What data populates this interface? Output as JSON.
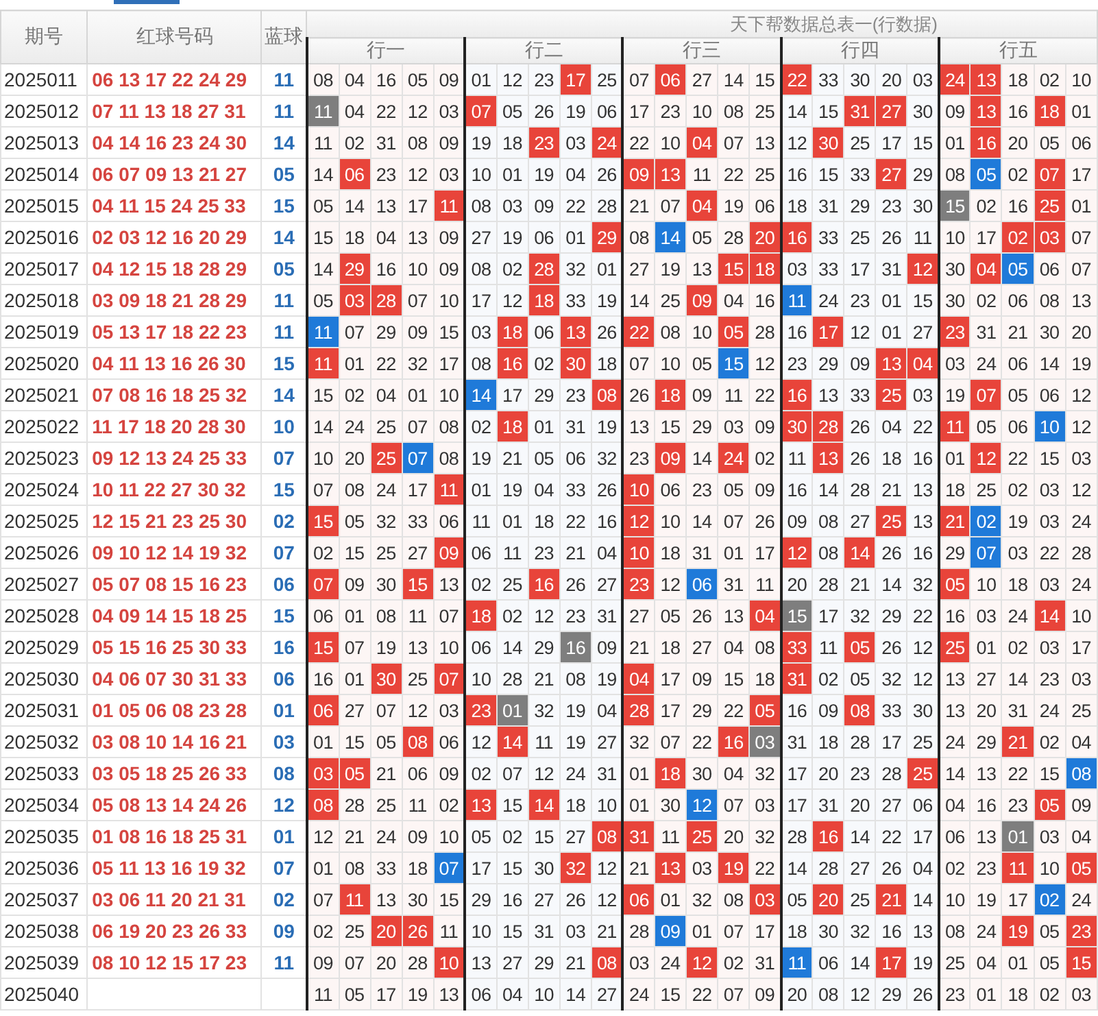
{
  "header": {
    "title": "天下帮数据总表一(行数据)",
    "columns": [
      "期号",
      "红球号码",
      "蓝球"
    ],
    "groups": [
      "行一",
      "行二",
      "行三",
      "行四",
      "行五"
    ]
  },
  "rows": [
    {
      "issue": "2025011",
      "red": "06 13 17 22 24 29",
      "blue": "11",
      "cells": [
        {
          "n": "08"
        },
        {
          "n": "04"
        },
        {
          "n": "16"
        },
        {
          "n": "05"
        },
        {
          "n": "09"
        },
        {
          "n": "01"
        },
        {
          "n": "12"
        },
        {
          "n": "23"
        },
        {
          "n": "17",
          "color": "#e8443a"
        },
        {
          "n": "25"
        },
        {
          "n": "07"
        },
        {
          "n": "06",
          "color": "#e8443a"
        },
        {
          "n": "27"
        },
        {
          "n": "14"
        },
        {
          "n": "15"
        },
        {
          "n": "22",
          "color": "#e8443a"
        },
        {
          "n": "33"
        },
        {
          "n": "30"
        },
        {
          "n": "20"
        },
        {
          "n": "03"
        },
        {
          "n": "24",
          "color": "#e8443a"
        },
        {
          "n": "13",
          "color": "#e8443a"
        },
        {
          "n": "18"
        },
        {
          "n": "02"
        },
        {
          "n": "10"
        }
      ]
    },
    {
      "issue": "2025012",
      "red": "07 11 13 18 27 31",
      "blue": "11",
      "cells": [
        {
          "n": "11",
          "color": "#7e7e7e"
        },
        {
          "n": "04"
        },
        {
          "n": "22"
        },
        {
          "n": "12"
        },
        {
          "n": "03"
        },
        {
          "n": "07",
          "color": "#e8443a"
        },
        {
          "n": "05"
        },
        {
          "n": "26"
        },
        {
          "n": "19"
        },
        {
          "n": "06"
        },
        {
          "n": "17"
        },
        {
          "n": "23"
        },
        {
          "n": "10"
        },
        {
          "n": "08"
        },
        {
          "n": "25"
        },
        {
          "n": "14"
        },
        {
          "n": "15"
        },
        {
          "n": "31",
          "color": "#e8443a"
        },
        {
          "n": "27",
          "color": "#e8443a"
        },
        {
          "n": "30"
        },
        {
          "n": "09"
        },
        {
          "n": "13",
          "color": "#e8443a"
        },
        {
          "n": "16"
        },
        {
          "n": "18",
          "color": "#e8443a"
        },
        {
          "n": "01"
        }
      ]
    },
    {
      "issue": "2025013",
      "red": "04 14 16 23 24 30",
      "blue": "14",
      "cells": [
        {
          "n": "11"
        },
        {
          "n": "02"
        },
        {
          "n": "31"
        },
        {
          "n": "08"
        },
        {
          "n": "09"
        },
        {
          "n": "19"
        },
        {
          "n": "18"
        },
        {
          "n": "23",
          "color": "#e8443a"
        },
        {
          "n": "03"
        },
        {
          "n": "24",
          "color": "#e8443a"
        },
        {
          "n": "22"
        },
        {
          "n": "10"
        },
        {
          "n": "04",
          "color": "#e8443a"
        },
        {
          "n": "07"
        },
        {
          "n": "13"
        },
        {
          "n": "12"
        },
        {
          "n": "30",
          "color": "#e8443a"
        },
        {
          "n": "25"
        },
        {
          "n": "17"
        },
        {
          "n": "15"
        },
        {
          "n": "01"
        },
        {
          "n": "16",
          "color": "#e8443a"
        },
        {
          "n": "20"
        },
        {
          "n": "05"
        },
        {
          "n": "06"
        }
      ]
    },
    {
      "issue": "2025014",
      "red": "06 07 09 13 21 27",
      "blue": "05",
      "cells": [
        {
          "n": "14"
        },
        {
          "n": "06",
          "color": "#e8443a"
        },
        {
          "n": "23"
        },
        {
          "n": "12"
        },
        {
          "n": "03"
        },
        {
          "n": "10"
        },
        {
          "n": "01"
        },
        {
          "n": "19"
        },
        {
          "n": "04"
        },
        {
          "n": "26"
        },
        {
          "n": "09",
          "color": "#e8443a"
        },
        {
          "n": "13",
          "color": "#e8443a"
        },
        {
          "n": "11"
        },
        {
          "n": "22"
        },
        {
          "n": "25"
        },
        {
          "n": "16"
        },
        {
          "n": "15"
        },
        {
          "n": "33"
        },
        {
          "n": "27",
          "color": "#e8443a"
        },
        {
          "n": "29"
        },
        {
          "n": "08"
        },
        {
          "n": "05",
          "color": "#1f7ad9"
        },
        {
          "n": "02"
        },
        {
          "n": "07",
          "color": "#e8443a"
        },
        {
          "n": "17"
        }
      ]
    },
    {
      "issue": "2025015",
      "red": "04 11 15 24 25 33",
      "blue": "15",
      "cells": [
        {
          "n": "05"
        },
        {
          "n": "14"
        },
        {
          "n": "13"
        },
        {
          "n": "17"
        },
        {
          "n": "11",
          "color": "#e8443a"
        },
        {
          "n": "08"
        },
        {
          "n": "03"
        },
        {
          "n": "09"
        },
        {
          "n": "22"
        },
        {
          "n": "28"
        },
        {
          "n": "21"
        },
        {
          "n": "07"
        },
        {
          "n": "04",
          "color": "#e8443a"
        },
        {
          "n": "19"
        },
        {
          "n": "06"
        },
        {
          "n": "18"
        },
        {
          "n": "31"
        },
        {
          "n": "29"
        },
        {
          "n": "23"
        },
        {
          "n": "30"
        },
        {
          "n": "15",
          "color": "#7e7e7e"
        },
        {
          "n": "02"
        },
        {
          "n": "16"
        },
        {
          "n": "25",
          "color": "#e8443a"
        },
        {
          "n": "01"
        }
      ]
    },
    {
      "issue": "2025016",
      "red": "02 03 12 16 20 29",
      "blue": "14",
      "cells": [
        {
          "n": "15"
        },
        {
          "n": "18"
        },
        {
          "n": "04"
        },
        {
          "n": "13"
        },
        {
          "n": "09"
        },
        {
          "n": "27"
        },
        {
          "n": "19"
        },
        {
          "n": "06"
        },
        {
          "n": "01"
        },
        {
          "n": "29",
          "color": "#e8443a"
        },
        {
          "n": "08"
        },
        {
          "n": "14",
          "color": "#1f7ad9"
        },
        {
          "n": "05"
        },
        {
          "n": "28"
        },
        {
          "n": "20",
          "color": "#e8443a"
        },
        {
          "n": "16",
          "color": "#e8443a"
        },
        {
          "n": "33"
        },
        {
          "n": "25"
        },
        {
          "n": "26"
        },
        {
          "n": "11"
        },
        {
          "n": "10"
        },
        {
          "n": "17"
        },
        {
          "n": "02",
          "color": "#e8443a"
        },
        {
          "n": "03",
          "color": "#e8443a"
        },
        {
          "n": "07"
        }
      ]
    },
    {
      "issue": "2025017",
      "red": "04 12 15 18 28 29",
      "blue": "05",
      "cells": [
        {
          "n": "14"
        },
        {
          "n": "29",
          "color": "#e8443a"
        },
        {
          "n": "16"
        },
        {
          "n": "10"
        },
        {
          "n": "09"
        },
        {
          "n": "08"
        },
        {
          "n": "02"
        },
        {
          "n": "28",
          "color": "#e8443a"
        },
        {
          "n": "32"
        },
        {
          "n": "01"
        },
        {
          "n": "27"
        },
        {
          "n": "19"
        },
        {
          "n": "13"
        },
        {
          "n": "15",
          "color": "#e8443a"
        },
        {
          "n": "18",
          "color": "#e8443a"
        },
        {
          "n": "03"
        },
        {
          "n": "33"
        },
        {
          "n": "17"
        },
        {
          "n": "31"
        },
        {
          "n": "12",
          "color": "#e8443a"
        },
        {
          "n": "30"
        },
        {
          "n": "04",
          "color": "#e8443a"
        },
        {
          "n": "05",
          "color": "#1f7ad9"
        },
        {
          "n": "06"
        },
        {
          "n": "07"
        }
      ]
    },
    {
      "issue": "2025018",
      "red": "03 09 18 21 28 29",
      "blue": "11",
      "cells": [
        {
          "n": "05"
        },
        {
          "n": "03",
          "color": "#e8443a"
        },
        {
          "n": "28",
          "color": "#e8443a"
        },
        {
          "n": "07"
        },
        {
          "n": "10"
        },
        {
          "n": "17"
        },
        {
          "n": "12"
        },
        {
          "n": "18",
          "color": "#e8443a"
        },
        {
          "n": "33"
        },
        {
          "n": "19"
        },
        {
          "n": "14"
        },
        {
          "n": "25"
        },
        {
          "n": "09",
          "color": "#e8443a"
        },
        {
          "n": "04"
        },
        {
          "n": "16"
        },
        {
          "n": "11",
          "color": "#1f7ad9"
        },
        {
          "n": "24"
        },
        {
          "n": "23"
        },
        {
          "n": "01"
        },
        {
          "n": "15"
        },
        {
          "n": "30"
        },
        {
          "n": "02"
        },
        {
          "n": "06"
        },
        {
          "n": "08"
        },
        {
          "n": "13"
        }
      ]
    },
    {
      "issue": "2025019",
      "red": "05 13 17 18 22 23",
      "blue": "11",
      "cells": [
        {
          "n": "11",
          "color": "#1f7ad9"
        },
        {
          "n": "07"
        },
        {
          "n": "29"
        },
        {
          "n": "09"
        },
        {
          "n": "15"
        },
        {
          "n": "03"
        },
        {
          "n": "18",
          "color": "#e8443a"
        },
        {
          "n": "06"
        },
        {
          "n": "13",
          "color": "#e8443a"
        },
        {
          "n": "26"
        },
        {
          "n": "22",
          "color": "#e8443a"
        },
        {
          "n": "08"
        },
        {
          "n": "10"
        },
        {
          "n": "05",
          "color": "#e8443a"
        },
        {
          "n": "28"
        },
        {
          "n": "16"
        },
        {
          "n": "17",
          "color": "#e8443a"
        },
        {
          "n": "12"
        },
        {
          "n": "01"
        },
        {
          "n": "27"
        },
        {
          "n": "23",
          "color": "#e8443a"
        },
        {
          "n": "31"
        },
        {
          "n": "21"
        },
        {
          "n": "30"
        },
        {
          "n": "20"
        }
      ]
    },
    {
      "issue": "2025020",
      "red": "04 11 13 16 26 30",
      "blue": "15",
      "cells": [
        {
          "n": "11",
          "color": "#e8443a"
        },
        {
          "n": "01"
        },
        {
          "n": "22"
        },
        {
          "n": "32"
        },
        {
          "n": "17"
        },
        {
          "n": "08"
        },
        {
          "n": "16",
          "color": "#e8443a"
        },
        {
          "n": "02"
        },
        {
          "n": "30",
          "color": "#e8443a"
        },
        {
          "n": "18"
        },
        {
          "n": "07"
        },
        {
          "n": "10"
        },
        {
          "n": "05"
        },
        {
          "n": "15",
          "color": "#1f7ad9"
        },
        {
          "n": "12"
        },
        {
          "n": "23"
        },
        {
          "n": "29"
        },
        {
          "n": "09"
        },
        {
          "n": "13",
          "color": "#e8443a"
        },
        {
          "n": "04",
          "color": "#e8443a"
        },
        {
          "n": "03"
        },
        {
          "n": "24"
        },
        {
          "n": "06"
        },
        {
          "n": "14"
        },
        {
          "n": "19"
        }
      ]
    },
    {
      "issue": "2025021",
      "red": "07 08 16 18 25 32",
      "blue": "14",
      "cells": [
        {
          "n": "15"
        },
        {
          "n": "02"
        },
        {
          "n": "04"
        },
        {
          "n": "01"
        },
        {
          "n": "10"
        },
        {
          "n": "14",
          "color": "#1f7ad9"
        },
        {
          "n": "17"
        },
        {
          "n": "29"
        },
        {
          "n": "23"
        },
        {
          "n": "08",
          "color": "#e8443a"
        },
        {
          "n": "26"
        },
        {
          "n": "18",
          "color": "#e8443a"
        },
        {
          "n": "09"
        },
        {
          "n": "11"
        },
        {
          "n": "22"
        },
        {
          "n": "16",
          "color": "#e8443a"
        },
        {
          "n": "13"
        },
        {
          "n": "33"
        },
        {
          "n": "25",
          "color": "#e8443a"
        },
        {
          "n": "03"
        },
        {
          "n": "19"
        },
        {
          "n": "07",
          "color": "#e8443a"
        },
        {
          "n": "05"
        },
        {
          "n": "06"
        },
        {
          "n": "12"
        }
      ]
    },
    {
      "issue": "2025022",
      "red": "11 17 18 20 28 30",
      "blue": "10",
      "cells": [
        {
          "n": "14"
        },
        {
          "n": "24"
        },
        {
          "n": "25"
        },
        {
          "n": "07"
        },
        {
          "n": "08"
        },
        {
          "n": "02"
        },
        {
          "n": "18",
          "color": "#e8443a"
        },
        {
          "n": "01"
        },
        {
          "n": "31"
        },
        {
          "n": "19"
        },
        {
          "n": "13"
        },
        {
          "n": "15"
        },
        {
          "n": "29"
        },
        {
          "n": "03"
        },
        {
          "n": "09"
        },
        {
          "n": "30",
          "color": "#e8443a"
        },
        {
          "n": "28",
          "color": "#e8443a"
        },
        {
          "n": "26"
        },
        {
          "n": "04"
        },
        {
          "n": "22"
        },
        {
          "n": "11",
          "color": "#e8443a"
        },
        {
          "n": "05"
        },
        {
          "n": "06"
        },
        {
          "n": "10",
          "color": "#1f7ad9"
        },
        {
          "n": "12"
        }
      ]
    },
    {
      "issue": "2025023",
      "red": "09 12 13 24 25 33",
      "blue": "07",
      "cells": [
        {
          "n": "10"
        },
        {
          "n": "20"
        },
        {
          "n": "25",
          "color": "#e8443a"
        },
        {
          "n": "07",
          "color": "#1f7ad9"
        },
        {
          "n": "08"
        },
        {
          "n": "19"
        },
        {
          "n": "21"
        },
        {
          "n": "05"
        },
        {
          "n": "06"
        },
        {
          "n": "32"
        },
        {
          "n": "23"
        },
        {
          "n": "09",
          "color": "#e8443a"
        },
        {
          "n": "14"
        },
        {
          "n": "24",
          "color": "#e8443a"
        },
        {
          "n": "02"
        },
        {
          "n": "11"
        },
        {
          "n": "13",
          "color": "#e8443a"
        },
        {
          "n": "26"
        },
        {
          "n": "18"
        },
        {
          "n": "16"
        },
        {
          "n": "01"
        },
        {
          "n": "12",
          "color": "#e8443a"
        },
        {
          "n": "22"
        },
        {
          "n": "15"
        },
        {
          "n": "03"
        }
      ]
    },
    {
      "issue": "2025024",
      "red": "10 11 22 27 30 32",
      "blue": "15",
      "cells": [
        {
          "n": "07"
        },
        {
          "n": "08"
        },
        {
          "n": "24"
        },
        {
          "n": "17"
        },
        {
          "n": "11",
          "color": "#e8443a"
        },
        {
          "n": "01"
        },
        {
          "n": "19"
        },
        {
          "n": "04"
        },
        {
          "n": "33"
        },
        {
          "n": "26"
        },
        {
          "n": "10",
          "color": "#e8443a"
        },
        {
          "n": "06"
        },
        {
          "n": "23"
        },
        {
          "n": "05"
        },
        {
          "n": "09"
        },
        {
          "n": "16"
        },
        {
          "n": "14"
        },
        {
          "n": "28"
        },
        {
          "n": "21"
        },
        {
          "n": "13"
        },
        {
          "n": "18"
        },
        {
          "n": "25"
        },
        {
          "n": "02"
        },
        {
          "n": "03"
        },
        {
          "n": "12"
        }
      ]
    },
    {
      "issue": "2025025",
      "red": "12 15 21 23 25 30",
      "blue": "02",
      "cells": [
        {
          "n": "15",
          "color": "#e8443a"
        },
        {
          "n": "05"
        },
        {
          "n": "32"
        },
        {
          "n": "33"
        },
        {
          "n": "06"
        },
        {
          "n": "11"
        },
        {
          "n": "01"
        },
        {
          "n": "18"
        },
        {
          "n": "22"
        },
        {
          "n": "16"
        },
        {
          "n": "12",
          "color": "#e8443a"
        },
        {
          "n": "10"
        },
        {
          "n": "14"
        },
        {
          "n": "07"
        },
        {
          "n": "26"
        },
        {
          "n": "09"
        },
        {
          "n": "08"
        },
        {
          "n": "27"
        },
        {
          "n": "25",
          "color": "#e8443a"
        },
        {
          "n": "13"
        },
        {
          "n": "21",
          "color": "#e8443a"
        },
        {
          "n": "02",
          "color": "#1f7ad9"
        },
        {
          "n": "19"
        },
        {
          "n": "03"
        },
        {
          "n": "24"
        }
      ]
    },
    {
      "issue": "2025026",
      "red": "09 10 12 14 19 32",
      "blue": "07",
      "cells": [
        {
          "n": "02"
        },
        {
          "n": "15"
        },
        {
          "n": "25"
        },
        {
          "n": "27"
        },
        {
          "n": "09",
          "color": "#e8443a"
        },
        {
          "n": "06"
        },
        {
          "n": "11"
        },
        {
          "n": "23"
        },
        {
          "n": "21"
        },
        {
          "n": "04"
        },
        {
          "n": "10",
          "color": "#e8443a"
        },
        {
          "n": "18"
        },
        {
          "n": "31"
        },
        {
          "n": "01"
        },
        {
          "n": "17"
        },
        {
          "n": "12",
          "color": "#e8443a"
        },
        {
          "n": "08"
        },
        {
          "n": "14",
          "color": "#e8443a"
        },
        {
          "n": "26"
        },
        {
          "n": "16"
        },
        {
          "n": "29"
        },
        {
          "n": "07",
          "color": "#1f7ad9"
        },
        {
          "n": "03"
        },
        {
          "n": "22"
        },
        {
          "n": "28"
        }
      ]
    },
    {
      "issue": "2025027",
      "red": "05 07 08 15 16 23",
      "blue": "06",
      "cells": [
        {
          "n": "07",
          "color": "#e8443a"
        },
        {
          "n": "09"
        },
        {
          "n": "30"
        },
        {
          "n": "15",
          "color": "#e8443a"
        },
        {
          "n": "13"
        },
        {
          "n": "02"
        },
        {
          "n": "25"
        },
        {
          "n": "16",
          "color": "#e8443a"
        },
        {
          "n": "26"
        },
        {
          "n": "27"
        },
        {
          "n": "23",
          "color": "#e8443a"
        },
        {
          "n": "12"
        },
        {
          "n": "06",
          "color": "#1f7ad9"
        },
        {
          "n": "31"
        },
        {
          "n": "11"
        },
        {
          "n": "20"
        },
        {
          "n": "28"
        },
        {
          "n": "21"
        },
        {
          "n": "14"
        },
        {
          "n": "32"
        },
        {
          "n": "05",
          "color": "#e8443a"
        },
        {
          "n": "10"
        },
        {
          "n": "18"
        },
        {
          "n": "03"
        },
        {
          "n": "24"
        }
      ]
    },
    {
      "issue": "2025028",
      "red": "04 09 14 15 18 25",
      "blue": "15",
      "cells": [
        {
          "n": "06"
        },
        {
          "n": "01"
        },
        {
          "n": "08"
        },
        {
          "n": "11"
        },
        {
          "n": "07"
        },
        {
          "n": "18",
          "color": "#e8443a"
        },
        {
          "n": "02"
        },
        {
          "n": "12"
        },
        {
          "n": "23"
        },
        {
          "n": "31"
        },
        {
          "n": "27"
        },
        {
          "n": "05"
        },
        {
          "n": "26"
        },
        {
          "n": "13"
        },
        {
          "n": "04",
          "color": "#e8443a"
        },
        {
          "n": "15",
          "color": "#7e7e7e"
        },
        {
          "n": "17"
        },
        {
          "n": "32"
        },
        {
          "n": "29"
        },
        {
          "n": "22"
        },
        {
          "n": "16"
        },
        {
          "n": "03"
        },
        {
          "n": "24"
        },
        {
          "n": "14",
          "color": "#e8443a"
        },
        {
          "n": "10"
        }
      ]
    },
    {
      "issue": "2025029",
      "red": "05 15 16 25 30 33",
      "blue": "16",
      "cells": [
        {
          "n": "15",
          "color": "#e8443a"
        },
        {
          "n": "07"
        },
        {
          "n": "19"
        },
        {
          "n": "13"
        },
        {
          "n": "10"
        },
        {
          "n": "06"
        },
        {
          "n": "14"
        },
        {
          "n": "29"
        },
        {
          "n": "16",
          "color": "#7e7e7e"
        },
        {
          "n": "09"
        },
        {
          "n": "21"
        },
        {
          "n": "18"
        },
        {
          "n": "27"
        },
        {
          "n": "04"
        },
        {
          "n": "08"
        },
        {
          "n": "33",
          "color": "#e8443a"
        },
        {
          "n": "11"
        },
        {
          "n": "05",
          "color": "#e8443a"
        },
        {
          "n": "26"
        },
        {
          "n": "12"
        },
        {
          "n": "25",
          "color": "#e8443a"
        },
        {
          "n": "01"
        },
        {
          "n": "02"
        },
        {
          "n": "03"
        },
        {
          "n": "17"
        }
      ]
    },
    {
      "issue": "2025030",
      "red": "04 06 07 30 31 33",
      "blue": "06",
      "cells": [
        {
          "n": "16"
        },
        {
          "n": "01"
        },
        {
          "n": "30",
          "color": "#e8443a"
        },
        {
          "n": "25"
        },
        {
          "n": "07",
          "color": "#e8443a"
        },
        {
          "n": "10"
        },
        {
          "n": "28"
        },
        {
          "n": "21"
        },
        {
          "n": "08"
        },
        {
          "n": "19"
        },
        {
          "n": "04",
          "color": "#e8443a"
        },
        {
          "n": "17"
        },
        {
          "n": "09"
        },
        {
          "n": "15"
        },
        {
          "n": "18"
        },
        {
          "n": "31",
          "color": "#e8443a"
        },
        {
          "n": "02"
        },
        {
          "n": "05"
        },
        {
          "n": "32"
        },
        {
          "n": "12"
        },
        {
          "n": "13"
        },
        {
          "n": "27"
        },
        {
          "n": "14"
        },
        {
          "n": "23"
        },
        {
          "n": "03"
        }
      ]
    },
    {
      "issue": "2025031",
      "red": "01 05 06 08 23 28",
      "blue": "01",
      "cells": [
        {
          "n": "06",
          "color": "#e8443a"
        },
        {
          "n": "27"
        },
        {
          "n": "07"
        },
        {
          "n": "12"
        },
        {
          "n": "03"
        },
        {
          "n": "23",
          "color": "#e8443a"
        },
        {
          "n": "01",
          "color": "#7e7e7e"
        },
        {
          "n": "32"
        },
        {
          "n": "19"
        },
        {
          "n": "04"
        },
        {
          "n": "28",
          "color": "#e8443a"
        },
        {
          "n": "17"
        },
        {
          "n": "29"
        },
        {
          "n": "22"
        },
        {
          "n": "05",
          "color": "#e8443a"
        },
        {
          "n": "16"
        },
        {
          "n": "09"
        },
        {
          "n": "08",
          "color": "#e8443a"
        },
        {
          "n": "33"
        },
        {
          "n": "30"
        },
        {
          "n": "13"
        },
        {
          "n": "20"
        },
        {
          "n": "31"
        },
        {
          "n": "24"
        },
        {
          "n": "25"
        }
      ]
    },
    {
      "issue": "2025032",
      "red": "03 08 10 14 16 21",
      "blue": "03",
      "cells": [
        {
          "n": "01"
        },
        {
          "n": "15"
        },
        {
          "n": "05"
        },
        {
          "n": "08",
          "color": "#e8443a"
        },
        {
          "n": "06"
        },
        {
          "n": "12"
        },
        {
          "n": "14",
          "color": "#e8443a"
        },
        {
          "n": "11"
        },
        {
          "n": "19"
        },
        {
          "n": "27"
        },
        {
          "n": "32"
        },
        {
          "n": "07"
        },
        {
          "n": "22"
        },
        {
          "n": "16",
          "color": "#e8443a"
        },
        {
          "n": "03",
          "color": "#7e7e7e"
        },
        {
          "n": "31"
        },
        {
          "n": "18"
        },
        {
          "n": "28"
        },
        {
          "n": "17"
        },
        {
          "n": "25"
        },
        {
          "n": "24"
        },
        {
          "n": "29"
        },
        {
          "n": "21",
          "color": "#e8443a"
        },
        {
          "n": "02"
        },
        {
          "n": "04"
        }
      ]
    },
    {
      "issue": "2025033",
      "red": "03 05 18 25 26 33",
      "blue": "08",
      "cells": [
        {
          "n": "03",
          "color": "#e8443a"
        },
        {
          "n": "05",
          "color": "#e8443a"
        },
        {
          "n": "21"
        },
        {
          "n": "06"
        },
        {
          "n": "09"
        },
        {
          "n": "02"
        },
        {
          "n": "07"
        },
        {
          "n": "12"
        },
        {
          "n": "24"
        },
        {
          "n": "31"
        },
        {
          "n": "01"
        },
        {
          "n": "18",
          "color": "#e8443a"
        },
        {
          "n": "30"
        },
        {
          "n": "04"
        },
        {
          "n": "32"
        },
        {
          "n": "17"
        },
        {
          "n": "20"
        },
        {
          "n": "23"
        },
        {
          "n": "28"
        },
        {
          "n": "25",
          "color": "#e8443a"
        },
        {
          "n": "14"
        },
        {
          "n": "13"
        },
        {
          "n": "22"
        },
        {
          "n": "15"
        },
        {
          "n": "08",
          "color": "#1f7ad9"
        }
      ]
    },
    {
      "issue": "2025034",
      "red": "05 08 13 14 24 26",
      "blue": "12",
      "cells": [
        {
          "n": "08",
          "color": "#e8443a"
        },
        {
          "n": "28"
        },
        {
          "n": "25"
        },
        {
          "n": "11"
        },
        {
          "n": "02"
        },
        {
          "n": "13",
          "color": "#e8443a"
        },
        {
          "n": "15"
        },
        {
          "n": "14",
          "color": "#e8443a"
        },
        {
          "n": "18"
        },
        {
          "n": "10"
        },
        {
          "n": "01"
        },
        {
          "n": "30"
        },
        {
          "n": "12",
          "color": "#1f7ad9"
        },
        {
          "n": "07"
        },
        {
          "n": "03"
        },
        {
          "n": "17"
        },
        {
          "n": "31"
        },
        {
          "n": "20"
        },
        {
          "n": "27"
        },
        {
          "n": "06"
        },
        {
          "n": "04"
        },
        {
          "n": "16"
        },
        {
          "n": "23"
        },
        {
          "n": "05",
          "color": "#e8443a"
        },
        {
          "n": "09"
        }
      ]
    },
    {
      "issue": "2025035",
      "red": "01 08 16 18 25 31",
      "blue": "01",
      "cells": [
        {
          "n": "12"
        },
        {
          "n": "21"
        },
        {
          "n": "24"
        },
        {
          "n": "09"
        },
        {
          "n": "10"
        },
        {
          "n": "05"
        },
        {
          "n": "02"
        },
        {
          "n": "15"
        },
        {
          "n": "27"
        },
        {
          "n": "08",
          "color": "#e8443a"
        },
        {
          "n": "31",
          "color": "#e8443a"
        },
        {
          "n": "11"
        },
        {
          "n": "25",
          "color": "#e8443a"
        },
        {
          "n": "20"
        },
        {
          "n": "32"
        },
        {
          "n": "28"
        },
        {
          "n": "16",
          "color": "#e8443a"
        },
        {
          "n": "14"
        },
        {
          "n": "22"
        },
        {
          "n": "17"
        },
        {
          "n": "06"
        },
        {
          "n": "13"
        },
        {
          "n": "01",
          "color": "#7e7e7e"
        },
        {
          "n": "03"
        },
        {
          "n": "04"
        }
      ]
    },
    {
      "issue": "2025036",
      "red": "05 11 13 16 19 32",
      "blue": "07",
      "cells": [
        {
          "n": "01"
        },
        {
          "n": "08"
        },
        {
          "n": "33"
        },
        {
          "n": "18"
        },
        {
          "n": "07",
          "color": "#1f7ad9"
        },
        {
          "n": "17"
        },
        {
          "n": "15"
        },
        {
          "n": "30"
        },
        {
          "n": "32",
          "color": "#e8443a"
        },
        {
          "n": "12"
        },
        {
          "n": "21"
        },
        {
          "n": "13",
          "color": "#e8443a"
        },
        {
          "n": "03"
        },
        {
          "n": "19",
          "color": "#e8443a"
        },
        {
          "n": "22"
        },
        {
          "n": "14"
        },
        {
          "n": "28"
        },
        {
          "n": "27"
        },
        {
          "n": "26"
        },
        {
          "n": "04"
        },
        {
          "n": "02"
        },
        {
          "n": "23"
        },
        {
          "n": "11",
          "color": "#e8443a"
        },
        {
          "n": "10"
        },
        {
          "n": "05",
          "color": "#e8443a"
        }
      ]
    },
    {
      "issue": "2025037",
      "red": "03 06 11 20 21 31",
      "blue": "02",
      "cells": [
        {
          "n": "07"
        },
        {
          "n": "11",
          "color": "#e8443a"
        },
        {
          "n": "13"
        },
        {
          "n": "30"
        },
        {
          "n": "15"
        },
        {
          "n": "29"
        },
        {
          "n": "16"
        },
        {
          "n": "27"
        },
        {
          "n": "26"
        },
        {
          "n": "12"
        },
        {
          "n": "06",
          "color": "#e8443a"
        },
        {
          "n": "01"
        },
        {
          "n": "32"
        },
        {
          "n": "08"
        },
        {
          "n": "03",
          "color": "#e8443a"
        },
        {
          "n": "05"
        },
        {
          "n": "20",
          "color": "#e8443a"
        },
        {
          "n": "25"
        },
        {
          "n": "21",
          "color": "#e8443a"
        },
        {
          "n": "14"
        },
        {
          "n": "10"
        },
        {
          "n": "19"
        },
        {
          "n": "17"
        },
        {
          "n": "02",
          "color": "#1f7ad9"
        },
        {
          "n": "24"
        }
      ]
    },
    {
      "issue": "2025038",
      "red": "06 19 20 23 26 33",
      "blue": "09",
      "cells": [
        {
          "n": "02"
        },
        {
          "n": "25"
        },
        {
          "n": "20",
          "color": "#e8443a"
        },
        {
          "n": "26",
          "color": "#e8443a"
        },
        {
          "n": "11"
        },
        {
          "n": "10"
        },
        {
          "n": "15"
        },
        {
          "n": "31"
        },
        {
          "n": "03"
        },
        {
          "n": "21"
        },
        {
          "n": "28"
        },
        {
          "n": "09",
          "color": "#1f7ad9"
        },
        {
          "n": "01"
        },
        {
          "n": "07"
        },
        {
          "n": "17"
        },
        {
          "n": "18"
        },
        {
          "n": "30"
        },
        {
          "n": "32"
        },
        {
          "n": "16"
        },
        {
          "n": "13"
        },
        {
          "n": "08"
        },
        {
          "n": "24"
        },
        {
          "n": "19",
          "color": "#e8443a"
        },
        {
          "n": "05"
        },
        {
          "n": "23",
          "color": "#e8443a"
        }
      ]
    },
    {
      "issue": "2025039",
      "red": "08 10 12 15 17 23",
      "blue": "11",
      "cells": [
        {
          "n": "09"
        },
        {
          "n": "07"
        },
        {
          "n": "20"
        },
        {
          "n": "28"
        },
        {
          "n": "10",
          "color": "#e8443a"
        },
        {
          "n": "13"
        },
        {
          "n": "27"
        },
        {
          "n": "29"
        },
        {
          "n": "21"
        },
        {
          "n": "08",
          "color": "#e8443a"
        },
        {
          "n": "03"
        },
        {
          "n": "24"
        },
        {
          "n": "12",
          "color": "#e8443a"
        },
        {
          "n": "02"
        },
        {
          "n": "31"
        },
        {
          "n": "11",
          "color": "#1f7ad9"
        },
        {
          "n": "06"
        },
        {
          "n": "14"
        },
        {
          "n": "17",
          "color": "#e8443a"
        },
        {
          "n": "19"
        },
        {
          "n": "25"
        },
        {
          "n": "04"
        },
        {
          "n": "01"
        },
        {
          "n": "05"
        },
        {
          "n": "15",
          "color": "#e8443a"
        }
      ]
    },
    {
      "issue": "2025040",
      "cells": [
        {
          "n": "11"
        },
        {
          "n": "05"
        },
        {
          "n": "17"
        },
        {
          "n": "19"
        },
        {
          "n": "13"
        },
        {
          "n": "06"
        },
        {
          "n": "04"
        },
        {
          "n": "10"
        },
        {
          "n": "14"
        },
        {
          "n": "27"
        },
        {
          "n": "24"
        },
        {
          "n": "15"
        },
        {
          "n": "22"
        },
        {
          "n": "07"
        },
        {
          "n": "09"
        },
        {
          "n": "20"
        },
        {
          "n": "08"
        },
        {
          "n": "12"
        },
        {
          "n": "29"
        },
        {
          "n": "26"
        },
        {
          "n": "23"
        },
        {
          "n": "01"
        },
        {
          "n": "18"
        },
        {
          "n": "02"
        },
        {
          "n": "03"
        }
      ]
    }
  ]
}
